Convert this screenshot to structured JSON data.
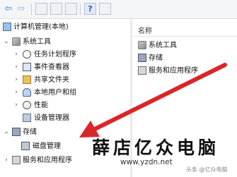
{
  "toolbar": {
    "back_glyph": "⇦",
    "forward_glyph": "⇨",
    "help_glyph": "?"
  },
  "tree": {
    "root": "计算机管理(本地)",
    "items": [
      "系统工具",
      "任务计划程序",
      "事件查看器",
      "共享文件夹",
      "本地用户和组",
      "性能",
      "设备管理器",
      "存储",
      "磁盘管理",
      "服务和应用程序"
    ],
    "expanders": [
      "⌄",
      "›",
      "›",
      "›",
      "›",
      "›",
      "⌄",
      "›"
    ]
  },
  "list": {
    "column_header": "名称",
    "items": [
      "系统工具",
      "存储",
      "服务和应用程序"
    ]
  },
  "colors": {
    "annotation_arrow": "#d9262a"
  },
  "watermark": {
    "title": "薛店亿众电脑",
    "url": "www.yzdn.net",
    "credit": "头条 @亿众电脑"
  }
}
